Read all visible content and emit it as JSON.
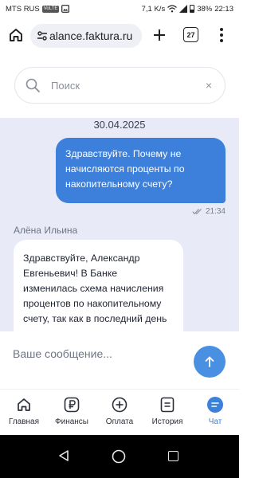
{
  "status_bar": {
    "carrier": "MTS RUS",
    "network_badge": "VoLTE",
    "speed": "7,1 K/s",
    "battery": "38%",
    "time": "22:13"
  },
  "browser": {
    "url": "alance.faktura.ru",
    "tab_count": "27",
    "icons": [
      "home-icon",
      "site-settings-icon",
      "plus-icon",
      "more-vert-icon"
    ]
  },
  "search": {
    "placeholder": "Поиск",
    "clear_symbol": "×"
  },
  "chat": {
    "date": "30.04.2025",
    "outgoing": {
      "text": "Здравствуйте. Почему не начисляются проценты по накопительному счету?",
      "time": "21:34",
      "status_icon": "double-check-icon"
    },
    "incoming": {
      "sender": "Алёна Ильина",
      "text": "Здравствуйте, Александр Евгеньевич! В Банке изменилась схема начисления процентов по накопительному счету, так как в последний день месяца"
    }
  },
  "composer": {
    "placeholder": "Ваше сообщение..."
  },
  "bottom_nav": {
    "items": [
      {
        "label": "Главная",
        "icon": "home-icon"
      },
      {
        "label": "Финансы",
        "icon": "ruble-icon"
      },
      {
        "label": "Оплата",
        "icon": "plus-circle-icon"
      },
      {
        "label": "История",
        "icon": "history-icon"
      },
      {
        "label": "Чат",
        "icon": "chat-icon",
        "active": true
      }
    ]
  },
  "colors": {
    "accent": "#3d80dc",
    "chat_background": "#e8eaf8",
    "outgoing_bubble": "#3d80dc",
    "incoming_bubble": "#ffffff"
  }
}
